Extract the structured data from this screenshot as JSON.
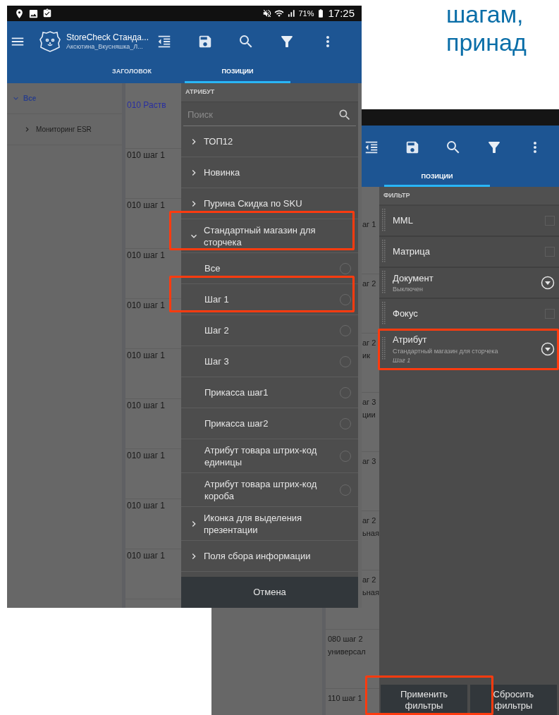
{
  "slide_heading": {
    "lines": [
      "шагам,",
      "принад"
    ]
  },
  "left_screen": {
    "status_bar": {
      "battery": "71%",
      "time": "17:25"
    },
    "app_bar": {
      "title": "StoreCheck Станда...",
      "subtitle": "Аксютина_Вкусняшка_Л..."
    },
    "tabs": [
      {
        "label": "ЗАГОЛОВОК",
        "selected": false
      },
      {
        "label": "ПОЗИЦИИ",
        "selected": true
      }
    ],
    "tree": [
      {
        "label": "Все",
        "expanded": true,
        "children": [
          {
            "label": "Мониторинг ESR",
            "expanded": false
          }
        ]
      }
    ],
    "list": [
      {
        "text": "010 Раств",
        "kind": "link"
      },
      {
        "text": "010 шаг 1",
        "kind": "plain"
      },
      {
        "text": "010 шаг 1",
        "kind": "plain"
      },
      {
        "text": "010 шаг 1",
        "kind": "plain"
      },
      {
        "text": "010 шаг 1",
        "kind": "plain"
      },
      {
        "text": "010 шаг 1",
        "kind": "plain"
      },
      {
        "text": "010 шаг 1",
        "kind": "plain"
      },
      {
        "text": "010 шаг 1",
        "kind": "plain"
      },
      {
        "text": "010 шаг 1",
        "kind": "plain"
      },
      {
        "text": "010 шаг 1",
        "kind": "plain"
      }
    ],
    "attribute_panel": {
      "title": "АТРИБУТ",
      "search": {
        "placeholder": "Поиск"
      },
      "items": [
        {
          "label": "ТОП12",
          "expanded": false,
          "highlighted": false
        },
        {
          "label": "Новинка",
          "expanded": false,
          "highlighted": false
        },
        {
          "label": "Пурина Скидка по SKU",
          "expanded": false,
          "highlighted": false
        },
        {
          "label": "Стандартный магазин для сторчека",
          "expanded": true,
          "highlighted": true,
          "children": [
            {
              "label": "Все",
              "selected": false,
              "highlighted": false
            },
            {
              "label": "Шаг 1",
              "selected": false,
              "highlighted": true
            },
            {
              "label": "Шаг 2",
              "selected": false,
              "highlighted": false
            },
            {
              "label": "Шаг 3",
              "selected": false,
              "highlighted": false
            },
            {
              "label": "Прикасса шаг1",
              "selected": false,
              "highlighted": false
            },
            {
              "label": "Прикасса шаг2",
              "selected": false,
              "highlighted": false
            },
            {
              "label": "Атрибут товара штрих-код единицы",
              "selected": false,
              "highlighted": false
            },
            {
              "label": "Атрибут товара штрих-код короба",
              "selected": false,
              "highlighted": false
            }
          ]
        },
        {
          "label": "Иконка для выделения презентации",
          "expanded": false,
          "highlighted": false
        },
        {
          "label": "Поля сбора информации",
          "expanded": false,
          "highlighted": false
        }
      ],
      "cancel": "Отмена"
    }
  },
  "right_screen": {
    "tabs": [
      {
        "label": "ПОЗИЦИИ",
        "selected": true
      }
    ],
    "list": [
      {
        "lines": [
          "аг 1"
        ],
        "kind": "covered"
      },
      {
        "lines": [
          "аг 2"
        ],
        "kind": "covered"
      },
      {
        "lines": [
          "аг 2",
          "ик"
        ],
        "kind": "covered"
      },
      {
        "lines": [
          "аг 3",
          "ции"
        ],
        "kind": "covered"
      },
      {
        "lines": [
          "аг 3"
        ],
        "kind": "covered"
      },
      {
        "lines": [
          "аг 2",
          "ьная"
        ],
        "kind": "covered"
      },
      {
        "lines": [
          "аг 2",
          "ьная"
        ],
        "kind": "covered"
      },
      {
        "lines": [
          "080 шаг 2",
          "универсал"
        ],
        "kind": "full"
      },
      {
        "lines": [
          "110 шаг 1"
        ],
        "kind": "full"
      }
    ],
    "filter_panel": {
      "title": "ФИЛЬТР",
      "rows": [
        {
          "label": "MML",
          "kind": "checkbox",
          "checked": false,
          "highlighted": false
        },
        {
          "label": "Матрица",
          "kind": "checkbox",
          "checked": false,
          "highlighted": false
        },
        {
          "label": "Документ",
          "kind": "select",
          "value": "Выключен",
          "highlighted": false
        },
        {
          "label": "Фокус",
          "kind": "checkbox",
          "checked": false,
          "highlighted": false
        },
        {
          "label": "Атрибут",
          "kind": "select",
          "value": "Стандартный магазин для сторчека",
          "detail": "Шаг 1",
          "highlighted": true
        }
      ],
      "buttons": [
        {
          "label": "Применить фильтры",
          "highlighted": true
        },
        {
          "label": "Сбросить фильтры",
          "highlighted": false
        }
      ]
    }
  }
}
